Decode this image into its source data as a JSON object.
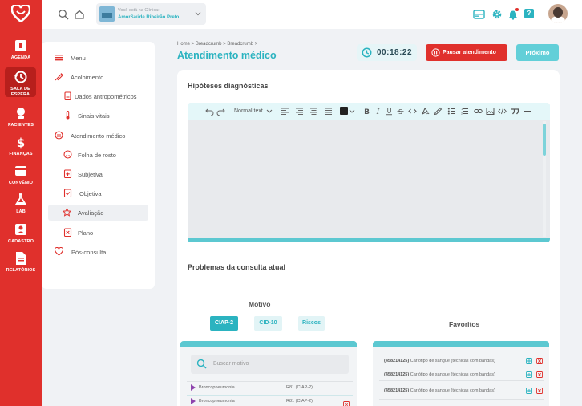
{
  "colors": {
    "brand": "#e0302c",
    "accent": "#2bb3c0",
    "accent_light": "#62cfd8"
  },
  "rail": {
    "logo": "heart-logo",
    "items": [
      {
        "label": "AGENDA",
        "icon": "calendar-icon"
      },
      {
        "label": "SALA DE ESPERA",
        "icon": "history-icon",
        "active": true
      },
      {
        "label": "PACIENTES",
        "icon": "user-icon"
      },
      {
        "label": "FINANÇAS",
        "icon": "dollar-icon"
      },
      {
        "label": "CONVÊNIO",
        "icon": "card-icon"
      },
      {
        "label": "LAB",
        "icon": "flask-icon"
      },
      {
        "label": "CADASTRO",
        "icon": "person-card-icon"
      },
      {
        "label": "RELATÓRIOS",
        "icon": "document-icon"
      }
    ]
  },
  "topbar": {
    "clinic_caption": "Você está na Clínica:",
    "clinic_name": "AmorSaúde Ribeirão Preto",
    "help_label": "?"
  },
  "sidemenu": {
    "items": [
      {
        "label": "Menu",
        "icon": "menu-icon"
      },
      {
        "label": "Acolhimento",
        "icon": "syringe-icon"
      },
      {
        "label": "Dados antropométricos",
        "icon": "clipboard-icon",
        "sub": true
      },
      {
        "label": "Sinais vitais",
        "icon": "thermometer-icon",
        "sub": true
      },
      {
        "label": "Atendimento médico",
        "icon": "stethoscope-icon"
      },
      {
        "label": "Folha de rosto",
        "icon": "face-icon",
        "sub": true
      },
      {
        "label": "Subjetiva",
        "icon": "clipboard-plus-icon",
        "sub": true
      },
      {
        "label": "Objetiva",
        "icon": "clipboard-check-icon",
        "sub": true
      },
      {
        "label": "Avaliação",
        "icon": "star-icon",
        "sub": true,
        "active": true
      },
      {
        "label": "Plano",
        "icon": "clipboard-cross-icon",
        "sub": true
      },
      {
        "label": "Pós-consulta",
        "icon": "heart-icon"
      }
    ]
  },
  "header": {
    "breadcrumb": "Home  >  Breadcrumb  >  Breadcrumb  >",
    "title": "Atendimento médico",
    "timer": "00:18:22",
    "pause_label": "Pausar atendimento",
    "next_label": "Próximo"
  },
  "main": {
    "hypotheses_title": "Hipóteses diagnósticas",
    "text_style": "Normal text",
    "problems_title": "Problemas da consulta atual",
    "motivo_label": "Motivo",
    "tabs": [
      "CIAP-2",
      "CID-10",
      "Riscos"
    ],
    "favorites_label": "Favoritos",
    "search_placeholder": "Buscar motivo",
    "motivos": [
      {
        "name": "Broncopneumonia",
        "code": "R81 (CIAP-2)"
      },
      {
        "name": "Broncopneumonia",
        "code": "R81 (CIAP-2)"
      }
    ],
    "favorites": [
      {
        "code": "(458214125)",
        "name": "Cariótipo de sangue (técnicas com bandas)"
      },
      {
        "code": "(458214125)",
        "name": "Cariótipo de sangue (técnicas com bandas)"
      },
      {
        "code": "(458214125)",
        "name": "Cariótipo de sangue (técnicas com bandas)"
      }
    ]
  }
}
